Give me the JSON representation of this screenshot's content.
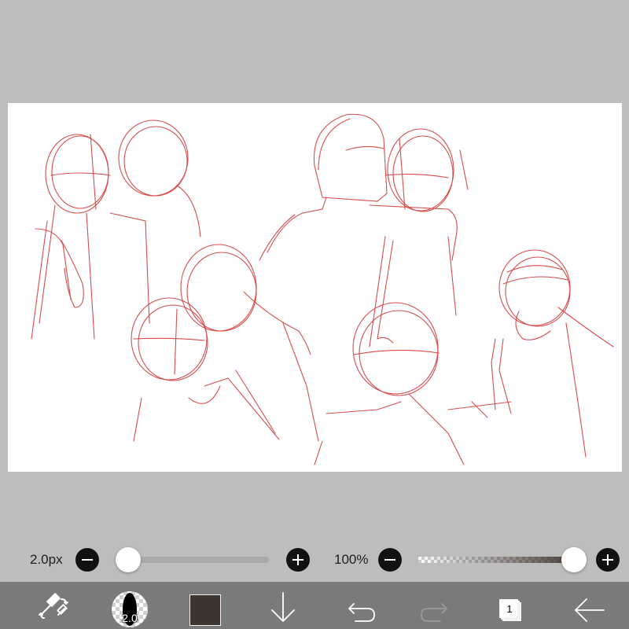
{
  "canvas": {
    "background": "#ffffff",
    "stroke_color": "#d23a3a"
  },
  "brush_size_slider": {
    "value_label": "2.0px",
    "level": 0.02,
    "decrease_icon": "minus-icon",
    "increase_icon": "plus-icon"
  },
  "opacity_slider": {
    "value_label": "100%",
    "level": 1.0,
    "decrease_icon": "minus-icon",
    "increase_icon": "plus-icon"
  },
  "toolbar": {
    "tools": [
      {
        "name": "eraser-swap-icon"
      },
      {
        "name": "brush-preview",
        "size_label": "2.0"
      },
      {
        "name": "color-swatch",
        "color": "#3e3530"
      },
      {
        "name": "download-icon"
      },
      {
        "name": "undo-icon"
      },
      {
        "name": "redo-icon",
        "disabled": true
      },
      {
        "name": "layers-icon",
        "layer_count": "1"
      },
      {
        "name": "back-arrow-icon"
      }
    ]
  }
}
